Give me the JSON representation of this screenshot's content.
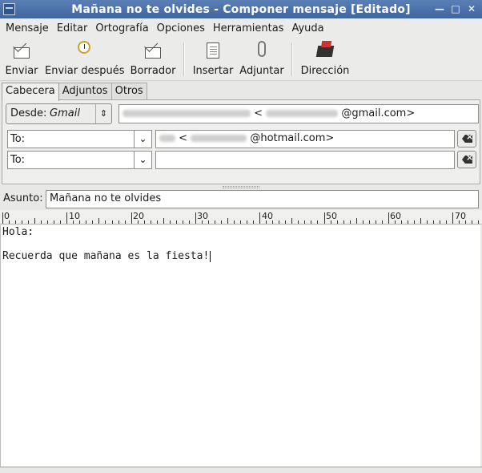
{
  "window": {
    "title": "Mañana no te olvides - Componer mensaje [Editado]"
  },
  "menubar": [
    "Mensaje",
    "Editar",
    "Ortografía",
    "Opciones",
    "Herramientas",
    "Ayuda"
  ],
  "toolbar": {
    "send": "Enviar",
    "send_later": "Enviar después",
    "draft": "Borrador",
    "insert": "Insertar",
    "attach": "Adjuntar",
    "address": "Dirección"
  },
  "icons": {
    "send": "envelope-send-icon",
    "send_later": "clock-envelope-icon",
    "draft": "draft-icon",
    "insert": "insert-pages-icon",
    "attach": "paperclip-icon",
    "address": "address-book-icon"
  },
  "tabs": [
    "Cabecera",
    "Adjuntos",
    "Otros"
  ],
  "header": {
    "from_label": "Desde:",
    "from_account": "Gmail",
    "from_address_sep": "<",
    "from_address_domain": "@gmail.com>",
    "recipients": [
      {
        "type": "To:",
        "address_sep": "<",
        "address_domain": "@hotmail.com>"
      },
      {
        "type": "To:",
        "address_sep": "",
        "address_domain": ""
      }
    ]
  },
  "subject": {
    "label": "Asunto:",
    "value": "Mañana no te olvides"
  },
  "ruler": [
    "0",
    "10",
    "20",
    "30",
    "40",
    "50",
    "60",
    "70"
  ],
  "body": {
    "lines": [
      "Hola:",
      "",
      "Recuerda que mañana es la fiesta!"
    ]
  }
}
